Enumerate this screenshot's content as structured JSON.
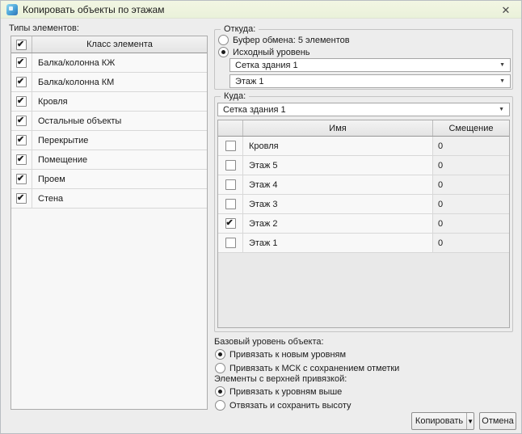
{
  "window": {
    "title": "Копировать объекты по этажам",
    "close_glyph": "✕"
  },
  "colors": {
    "titlebar_bg": "#eef3df",
    "dialog_bg": "#ededed",
    "icon_blue": "#4aa3d8"
  },
  "left_panel": {
    "label": "Типы элементов:",
    "table": {
      "header": "Класс элемента",
      "header_checked": true,
      "rows": [
        {
          "label": "Балка/колонна КЖ",
          "checked": true
        },
        {
          "label": "Балка/колонна КМ",
          "checked": true
        },
        {
          "label": "Кровля",
          "checked": true
        },
        {
          "label": "Остальные объекты",
          "checked": true
        },
        {
          "label": "Перекрытие",
          "checked": true
        },
        {
          "label": "Помещение",
          "checked": true
        },
        {
          "label": "Проем",
          "checked": true
        },
        {
          "label": "Стена",
          "checked": true
        }
      ]
    }
  },
  "from_group": {
    "label": "Откуда:",
    "options": [
      {
        "label": "Буфер обмена: 5 элементов",
        "selected": false
      },
      {
        "label": "Исходный уровень",
        "selected": true
      }
    ],
    "grid_select": "Сетка здания 1",
    "level_select": "Этаж 1"
  },
  "to_group": {
    "label": "Куда:",
    "grid_select": "Сетка здания 1",
    "table": {
      "columns": {
        "name": "Имя",
        "offset": "Смещение"
      },
      "rows": [
        {
          "name": "Кровля",
          "offset": "0",
          "checked": false
        },
        {
          "name": "Этаж 5",
          "offset": "0",
          "checked": false
        },
        {
          "name": "Этаж 4",
          "offset": "0",
          "checked": false
        },
        {
          "name": "Этаж 3",
          "offset": "0",
          "checked": false
        },
        {
          "name": "Этаж 2",
          "offset": "0",
          "checked": true
        },
        {
          "name": "Этаж 1",
          "offset": "0",
          "checked": false
        }
      ]
    }
  },
  "base_level_group": {
    "label": "Базовый уровень объекта:",
    "options": [
      {
        "label": "Привязать к новым уровням",
        "selected": true
      },
      {
        "label": "Привязать к МСК с сохранением отметки",
        "selected": false
      }
    ]
  },
  "top_binding_group": {
    "label": "Элементы с верхней привязкой:",
    "options": [
      {
        "label": "Привязать к уровням выше",
        "selected": true
      },
      {
        "label": "Отвязать и сохранить высоту",
        "selected": false
      }
    ]
  },
  "footer": {
    "copy_label": "Копировать",
    "copy_arrow": "▼",
    "cancel_label": "Отмена"
  },
  "combo_arrow": "▼"
}
